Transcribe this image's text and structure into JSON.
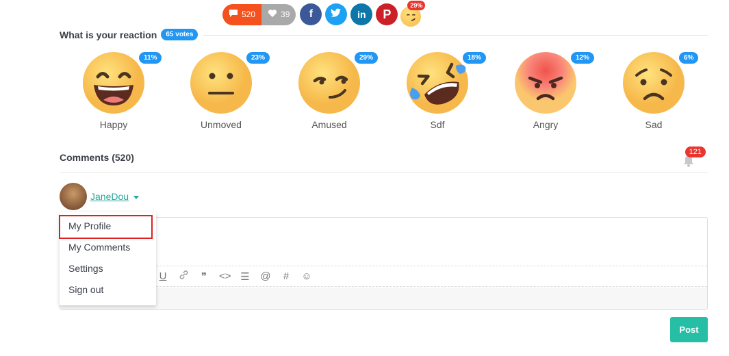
{
  "share": {
    "comment_count": "520",
    "like_count": "39",
    "social": [
      "facebook",
      "twitter",
      "linkedin",
      "pinterest"
    ],
    "mini_reaction_percent": "29%"
  },
  "reactions_section": {
    "title": "What is your reaction",
    "votes": "65 votes",
    "items": [
      {
        "label": "Happy",
        "percent": "11%"
      },
      {
        "label": "Unmoved",
        "percent": "23%"
      },
      {
        "label": "Amused",
        "percent": "29%"
      },
      {
        "label": "Sdf",
        "percent": "18%"
      },
      {
        "label": "Angry",
        "percent": "12%"
      },
      {
        "label": "Sad",
        "percent": "6%"
      }
    ]
  },
  "comments": {
    "title": "Comments (520)",
    "notification_count": "121"
  },
  "user": {
    "name": "JaneDou"
  },
  "dropdown": {
    "items": [
      "My Profile",
      "My Comments",
      "Settings",
      "Sign out"
    ]
  },
  "toolbar": {
    "underline": "U",
    "link": "🔗",
    "quote": "❞",
    "code": "<>",
    "list": "☰",
    "mention": "@",
    "hashtag": "#",
    "emoji": "☺"
  },
  "post_button": "Post",
  "colors": {
    "accent": "#26bfa6",
    "badge_blue": "#2196f3",
    "badge_red": "#e8352e",
    "highlight_red": "#e02020"
  }
}
